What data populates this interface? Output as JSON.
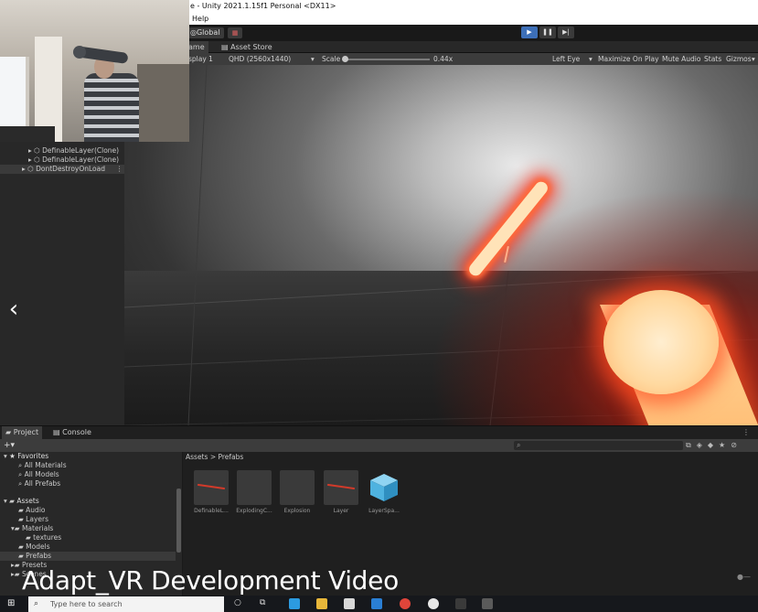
{
  "window": {
    "title": "e - Unity 2021.1.15f1 Personal <DX11>",
    "menu_help": "Help"
  },
  "toolbar": {
    "global_label": "Global",
    "play": "▶",
    "pause": "❚❚",
    "step": "▶|"
  },
  "game_view": {
    "tabs": [
      "ame",
      "Asset Store"
    ],
    "display": "splay 1",
    "resolution": "QHD (2560x1440)",
    "scale_label": "Scale",
    "scale_value": "0.44x",
    "eye": "Left Eye",
    "maximize": "Maximize On Play",
    "mute": "Mute Audio",
    "stats": "Stats",
    "gizmos": "Gizmos"
  },
  "hierarchy": {
    "items": [
      "DefinableLayer(Clone)",
      "DefinableLayer(Clone)",
      "DontDestroyOnLoad"
    ]
  },
  "project_panel": {
    "tabs": [
      "Project",
      "Console"
    ],
    "favorites_label": "Favorites",
    "favorites": [
      "All Materials",
      "All Models",
      "All Prefabs"
    ],
    "assets_label": "Assets",
    "folders": [
      "Audio",
      "Layers",
      "Materials",
      "textures",
      "Models",
      "Prefabs",
      "Presets",
      "Scenes"
    ],
    "breadcrumb": [
      "Assets",
      "Prefabs"
    ],
    "prefabs": [
      "DefinableL...",
      "ExplodingC...",
      "Explosion",
      "Layer",
      "LayerSpa..."
    ]
  },
  "caption": "Adapt_VR Development Video",
  "taskbar": {
    "search_placeholder": "Type here to search"
  },
  "colors": {
    "accent_blue": "#3d6fb8",
    "saber_glow": "#ff4a20",
    "prefab_cube": "#4fb3e0"
  }
}
